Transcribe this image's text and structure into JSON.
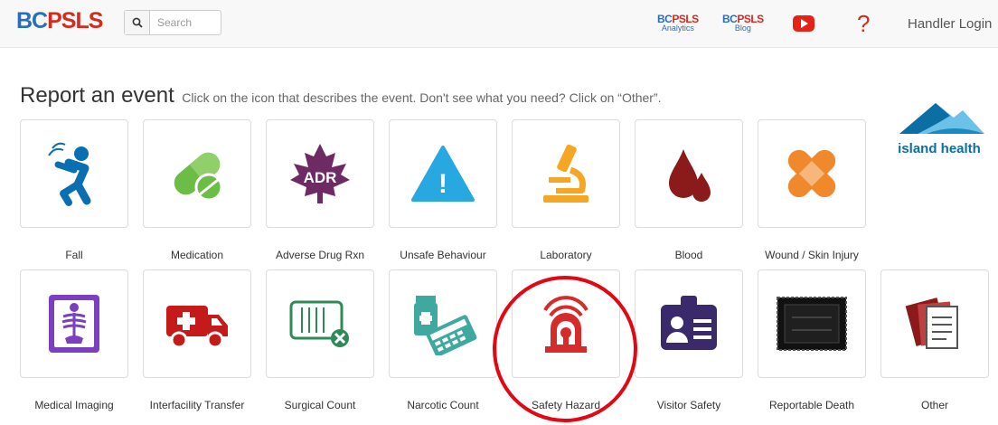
{
  "header": {
    "brand_bc": "BC",
    "brand_psls": "PSLS",
    "search_placeholder": "Search",
    "analytics": {
      "bc": "BC",
      "psls": "PSLS",
      "sub": "Analytics"
    },
    "blog": {
      "bc": "BC",
      "psls": "PSLS",
      "sub": "Blog"
    },
    "help": "?",
    "login": "Handler Login"
  },
  "main": {
    "title": "Report an event",
    "subtitle": "Click on the icon that describes the event. Don't see what you need? Click on “Other”."
  },
  "tiles": [
    {
      "label": "Fall",
      "icon": "fall-icon"
    },
    {
      "label": "Medication",
      "icon": "pill-icon"
    },
    {
      "label": "Adverse Drug Rxn",
      "icon": "adr-leaf-icon",
      "icon_text": "ADR"
    },
    {
      "label": "Unsafe Behaviour",
      "icon": "warning-icon",
      "icon_text": "!"
    },
    {
      "label": "Laboratory",
      "icon": "microscope-icon"
    },
    {
      "label": "Blood",
      "icon": "blood-drop-icon"
    },
    {
      "label": "Wound / Skin Injury",
      "icon": "bandage-icon"
    },
    {
      "label": "Medical Imaging",
      "icon": "xray-icon"
    },
    {
      "label": "Interfacility Transfer",
      "icon": "ambulance-icon"
    },
    {
      "label": "Surgical Count",
      "icon": "surgical-tray-icon"
    },
    {
      "label": "Narcotic Count",
      "icon": "calculator-icon"
    },
    {
      "label": "Safety Hazard",
      "icon": "alarm-icon"
    },
    {
      "label": "Visitor Safety",
      "icon": "id-badge-icon"
    },
    {
      "label": "Reportable Death",
      "icon": "framed-card-icon"
    },
    {
      "label": "Other",
      "icon": "documents-icon"
    }
  ],
  "logo": {
    "text": "island health"
  },
  "colors": {
    "brand_blue": "#2a6ebb",
    "brand_red": "#d52b1e",
    "highlight_red": "#e30613"
  }
}
